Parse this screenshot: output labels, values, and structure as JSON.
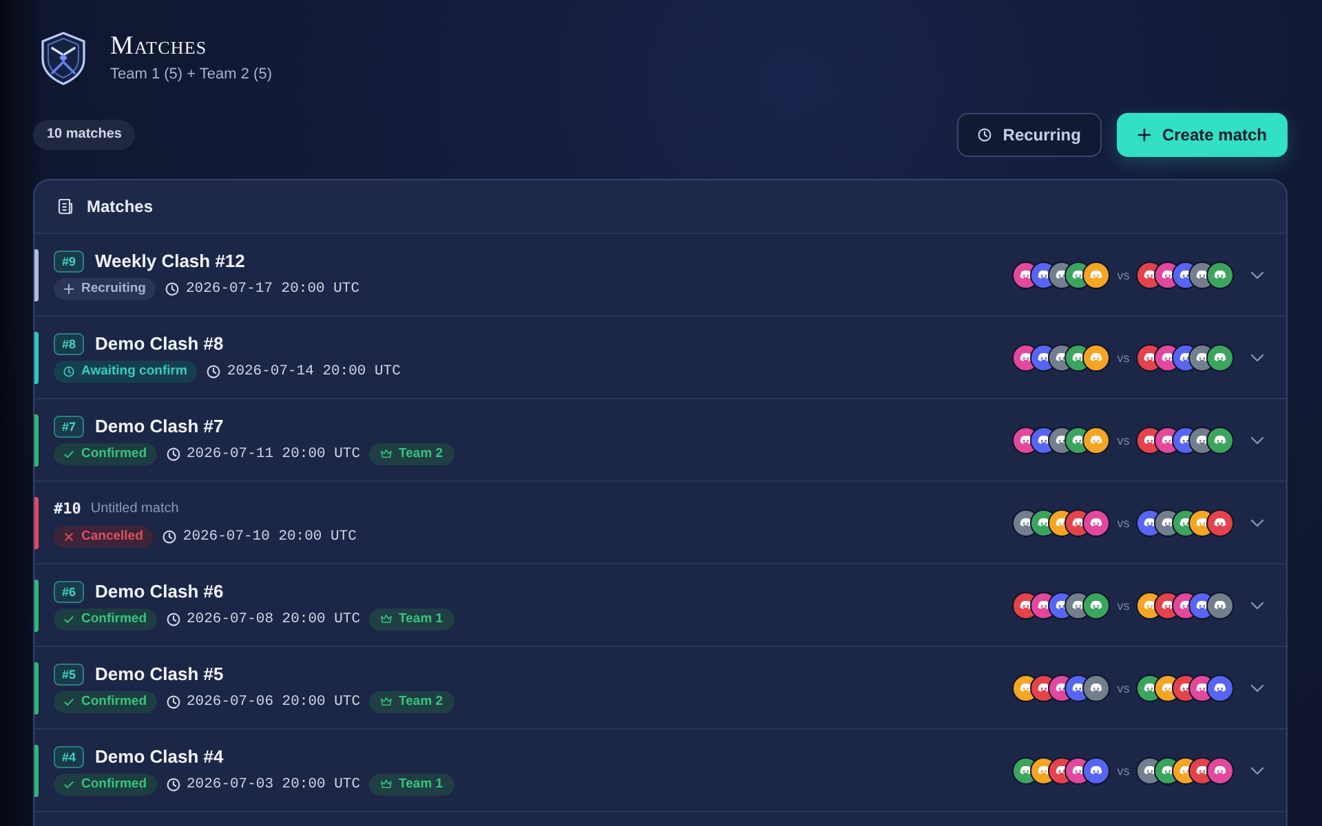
{
  "header": {
    "title": "Matches",
    "subtitle": "Team 1 (5) + Team 2 (5)"
  },
  "match_count": "10 matches",
  "actions": [
    {
      "label": "Recurring",
      "kind": "secondary"
    },
    {
      "label": "Create match",
      "kind": "primary"
    }
  ],
  "panel": {
    "title": "Matches"
  },
  "matches": [
    {
      "kind": "named",
      "number": "#9",
      "title": "Weekly Clash #12",
      "status": {
        "kind": "recruiting",
        "label": "Recruiting"
      },
      "time": "2026-07-17 20:00 UTC",
      "team_a": [
        {
          "color": "#e2489c"
        },
        {
          "color": "#5865f2"
        },
        {
          "color": "#747f8d"
        },
        {
          "color": "#3ba55d"
        },
        {
          "color": "#f5a524"
        }
      ],
      "separator": "vs",
      "team_b": [
        {
          "color": "#e5434b"
        },
        {
          "color": "#e2489c"
        },
        {
          "color": "#5865f2"
        },
        {
          "color": "#747f8d"
        },
        {
          "color": "#3ba55d"
        }
      ],
      "expanded": false
    },
    {
      "kind": "named",
      "number": "#8",
      "title": "Demo Clash #8",
      "status": {
        "kind": "awaiting",
        "label": "Awaiting confirm"
      },
      "time": "2026-07-14 20:00 UTC",
      "team_a": [
        {
          "color": "#e2489c"
        },
        {
          "color": "#5865f2"
        },
        {
          "color": "#747f8d"
        },
        {
          "color": "#3ba55d"
        },
        {
          "color": "#f5a524"
        }
      ],
      "separator": "vs",
      "team_b": [
        {
          "color": "#e5434b"
        },
        {
          "color": "#e2489c"
        },
        {
          "color": "#5865f2"
        },
        {
          "color": "#747f8d"
        },
        {
          "color": "#3ba55d"
        }
      ],
      "expanded": false
    },
    {
      "kind": "named",
      "number": "#7",
      "title": "Demo Clash #7",
      "status": {
        "kind": "confirmed",
        "label": "Confirmed"
      },
      "time": "2026-07-11 20:00 UTC",
      "winner": "Team 2",
      "team_a": [
        {
          "color": "#e2489c"
        },
        {
          "color": "#5865f2"
        },
        {
          "color": "#747f8d"
        },
        {
          "color": "#3ba55d"
        },
        {
          "color": "#f5a524"
        }
      ],
      "separator": "vs",
      "team_b": [
        {
          "color": "#e5434b"
        },
        {
          "color": "#e2489c"
        },
        {
          "color": "#5865f2"
        },
        {
          "color": "#747f8d"
        },
        {
          "color": "#3ba55d"
        }
      ],
      "expanded": false
    },
    {
      "kind": "untitled",
      "number": "#10",
      "title": "Untitled match",
      "status": {
        "kind": "cancelled",
        "label": "Cancelled"
      },
      "time": "2026-07-10 20:00 UTC",
      "team_a": [
        {
          "color": "#747f8d"
        },
        {
          "color": "#3ba55d"
        },
        {
          "color": "#f5a524"
        },
        {
          "color": "#e5434b"
        },
        {
          "color": "#e2489c"
        }
      ],
      "separator": "vs",
      "team_b": [
        {
          "color": "#5865f2"
        },
        {
          "color": "#747f8d"
        },
        {
          "color": "#3ba55d"
        },
        {
          "color": "#f5a524"
        },
        {
          "color": "#e5434b"
        }
      ],
      "expanded": false
    },
    {
      "kind": "named",
      "number": "#6",
      "title": "Demo Clash #6",
      "status": {
        "kind": "confirmed",
        "label": "Confirmed"
      },
      "time": "2026-07-08 20:00 UTC",
      "winner": "Team 1",
      "team_a": [
        {
          "color": "#e5434b"
        },
        {
          "color": "#e2489c"
        },
        {
          "color": "#5865f2"
        },
        {
          "color": "#747f8d"
        },
        {
          "color": "#3ba55d"
        }
      ],
      "separator": "vs",
      "team_b": [
        {
          "color": "#f5a524"
        },
        {
          "color": "#e5434b"
        },
        {
          "color": "#e2489c"
        },
        {
          "color": "#5865f2"
        },
        {
          "color": "#747f8d"
        }
      ],
      "expanded": false
    },
    {
      "kind": "named",
      "number": "#5",
      "title": "Demo Clash #5",
      "status": {
        "kind": "confirmed",
        "label": "Confirmed"
      },
      "time": "2026-07-06 20:00 UTC",
      "winner": "Team 2",
      "team_a": [
        {
          "color": "#f5a524"
        },
        {
          "color": "#e5434b"
        },
        {
          "color": "#e2489c"
        },
        {
          "color": "#5865f2"
        },
        {
          "color": "#747f8d"
        }
      ],
      "separator": "vs",
      "team_b": [
        {
          "color": "#3ba55d"
        },
        {
          "color": "#f5a524"
        },
        {
          "color": "#e5434b"
        },
        {
          "color": "#e2489c"
        },
        {
          "color": "#5865f2"
        }
      ],
      "expanded": false
    },
    {
      "kind": "named",
      "number": "#4",
      "title": "Demo Clash #4",
      "status": {
        "kind": "confirmed",
        "label": "Confirmed"
      },
      "time": "2026-07-03 20:00 UTC",
      "winner": "Team 1",
      "team_a": [
        {
          "color": "#3ba55d"
        },
        {
          "color": "#f5a524"
        },
        {
          "color": "#e5434b"
        },
        {
          "color": "#e2489c"
        },
        {
          "color": "#5865f2"
        }
      ],
      "separator": "vs",
      "team_b": [
        {
          "color": "#747f8d"
        },
        {
          "color": "#3ba55d"
        },
        {
          "color": "#f5a524"
        },
        {
          "color": "#e5434b"
        },
        {
          "color": "#e2489c"
        }
      ],
      "expanded": false
    }
  ]
}
